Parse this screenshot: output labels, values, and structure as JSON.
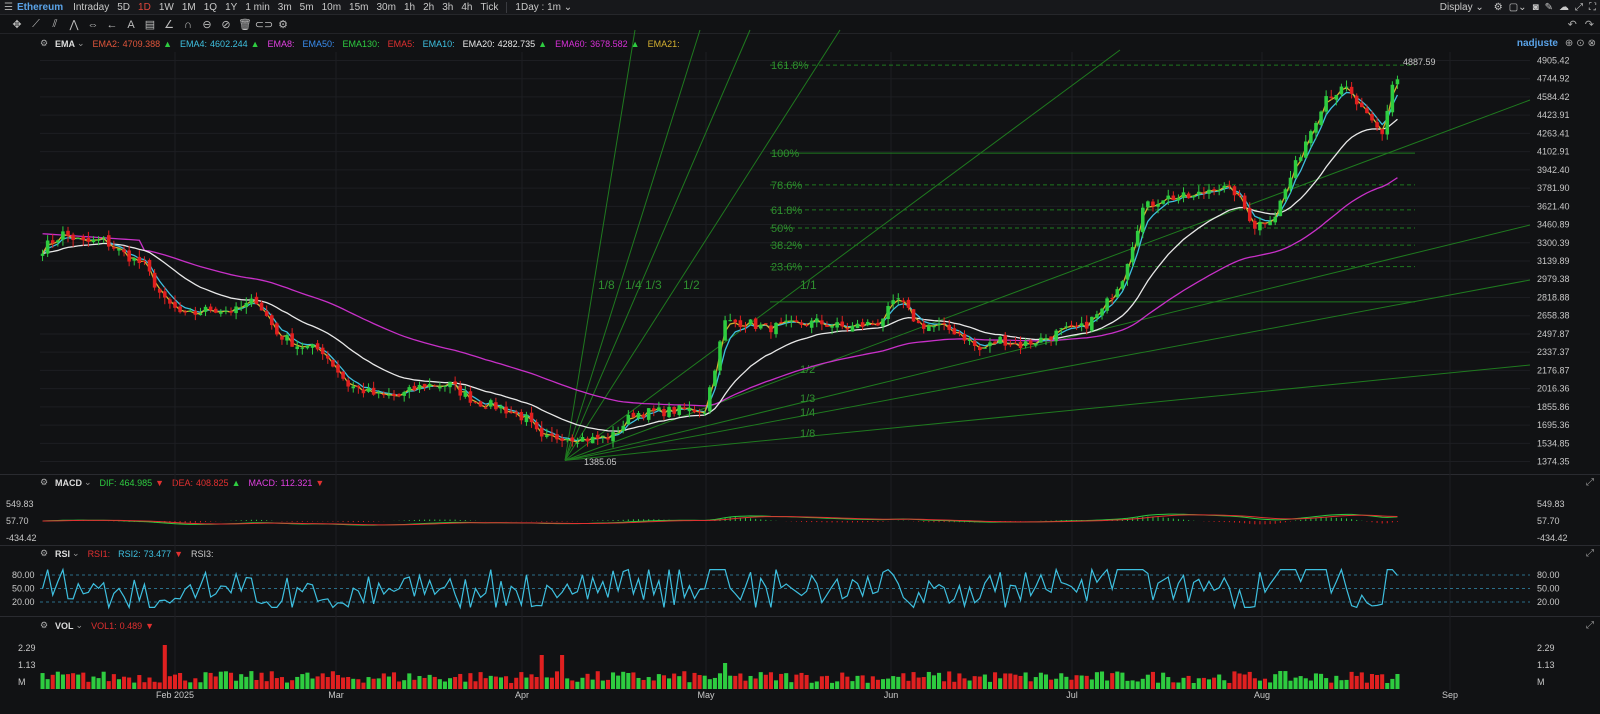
{
  "topbar": {
    "symbol": "Ethereum",
    "intraday": "Intraday",
    "ranges": [
      "5D",
      "1D",
      "1W",
      "1M",
      "1Q",
      "1Y"
    ],
    "active_range": "1D",
    "intervals": [
      "1 min",
      "3m",
      "5m",
      "10m",
      "15m",
      "30m",
      "1h",
      "2h",
      "3h",
      "4h",
      "Tick"
    ],
    "period_select": "1Day : 1m",
    "display": "Display"
  },
  "user": {
    "name": "nadjuste"
  },
  "main_legend": {
    "indicator": "EMA",
    "items": [
      {
        "label": "EMA2:",
        "value": "4709.388",
        "color": "#e0553b",
        "trend": "up"
      },
      {
        "label": "EMA4:",
        "value": "4602.244",
        "color": "#3ec0e0",
        "trend": "up"
      },
      {
        "label": "EMA8:",
        "value": "",
        "color": "#e040e0",
        "trend": ""
      },
      {
        "label": "EMA50:",
        "value": "",
        "color": "#3a8ef0",
        "trend": ""
      },
      {
        "label": "EMA130:",
        "value": "",
        "color": "#2ecc40",
        "trend": ""
      },
      {
        "label": "EMA5:",
        "value": "",
        "color": "#e03030",
        "trend": ""
      },
      {
        "label": "EMA10:",
        "value": "",
        "color": "#3ec0e0",
        "trend": ""
      },
      {
        "label": "EMA20:",
        "value": "4282.735",
        "color": "#e8e8e8",
        "trend": "up"
      },
      {
        "label": "EMA60:",
        "value": "3678.582",
        "color": "#d630d6",
        "trend": "up"
      },
      {
        "label": "EMA21:",
        "value": "",
        "color": "#d4b030",
        "trend": ""
      }
    ]
  },
  "macd_legend": {
    "indicator": "MACD",
    "items": [
      {
        "label": "DIF:",
        "value": "464.985",
        "color": "#2ecc40",
        "trend": "down"
      },
      {
        "label": "DEA:",
        "value": "408.825",
        "color": "#e03030",
        "trend": "up"
      },
      {
        "label": "MACD:",
        "value": "112.321",
        "color": "#e040e0",
        "trend": "down"
      }
    ]
  },
  "rsi_legend": {
    "indicator": "RSI",
    "items": [
      {
        "label": "RSI1:",
        "value": "",
        "color": "#e03030",
        "trend": ""
      },
      {
        "label": "RSI2:",
        "value": "73.477",
        "color": "#3ec0e0",
        "trend": "down"
      },
      {
        "label": "RSI3:",
        "value": "",
        "color": "#cccccc",
        "trend": ""
      }
    ]
  },
  "vol_legend": {
    "indicator": "VOL",
    "items": [
      {
        "label": "VOL1:",
        "value": "0.489",
        "color": "#e03030",
        "trend": "down"
      }
    ]
  },
  "chart_data": {
    "type": "candlestick",
    "x_labels": [
      "Feb 2025",
      "Mar",
      "Apr",
      "May",
      "Jun",
      "Jul",
      "Aug",
      "Sep"
    ],
    "price_axis_ticks": [
      "4905.42",
      "4744.92",
      "4584.42",
      "4423.91",
      "4263.41",
      "4102.91",
      "3942.40",
      "3781.90",
      "3621.40",
      "3460.89",
      "3300.39",
      "3139.89",
      "2979.38",
      "2818.88",
      "2658.38",
      "2497.87",
      "2337.37",
      "2176.87",
      "2016.36",
      "1855.86",
      "1695.36",
      "1534.85",
      "1374.35"
    ],
    "ylim": [
      1300,
      4980
    ],
    "high_label": "4887.59",
    "low_label": "1385.05",
    "fib_levels": [
      {
        "label": "161.8%",
        "value": 4865
      },
      {
        "label": "100%",
        "value": 4090
      },
      {
        "label": "78.6%",
        "value": 3810
      },
      {
        "label": "61.8%",
        "value": 3590
      },
      {
        "label": "50%",
        "value": 3430
      },
      {
        "label": "38.2%",
        "value": 3280
      },
      {
        "label": "23.6%",
        "value": 3090
      },
      {
        "label": "",
        "value": 2780
      }
    ],
    "gann_labels_upper": [
      "1/8",
      "1/4",
      "1/3",
      "1/2",
      "1/1"
    ],
    "gann_labels_lower": [
      "1/2",
      "1/3",
      "1/4",
      "1/8"
    ],
    "macd_axis_ticks": [
      "549.83",
      "57.70",
      "-434.42"
    ],
    "rsi_axis_ticks": [
      "80.00",
      "50.00",
      "20.00"
    ],
    "vol_axis_ticks": [
      "2.29",
      "1.13",
      "M"
    ],
    "anchors": [
      [
        0,
        3250
      ],
      [
        4,
        3380
      ],
      [
        8,
        3300
      ],
      [
        12,
        3320
      ],
      [
        16,
        3200
      ],
      [
        20,
        3100
      ],
      [
        24,
        2780
      ],
      [
        28,
        2650
      ],
      [
        33,
        2720
      ],
      [
        38,
        2700
      ],
      [
        42,
        2800
      ],
      [
        46,
        2500
      ],
      [
        50,
        2400
      ],
      [
        55,
        2350
      ],
      [
        60,
        2050
      ],
      [
        66,
        1950
      ],
      [
        70,
        1950
      ],
      [
        75,
        2050
      ],
      [
        80,
        2050
      ],
      [
        85,
        1900
      ],
      [
        90,
        1850
      ],
      [
        95,
        1750
      ],
      [
        98,
        1560
      ],
      [
        102,
        1600
      ],
      [
        108,
        1570
      ],
      [
        112,
        1600
      ],
      [
        116,
        1800
      ],
      [
        120,
        1810
      ],
      [
        126,
        1830
      ],
      [
        130,
        1830
      ],
      [
        134,
        2600
      ],
      [
        138,
        2600
      ],
      [
        142,
        2550
      ],
      [
        148,
        2580
      ],
      [
        152,
        2600
      ],
      [
        158,
        2550
      ],
      [
        164,
        2600
      ],
      [
        168,
        2800
      ],
      [
        172,
        2580
      ],
      [
        176,
        2560
      ],
      [
        180,
        2510
      ],
      [
        184,
        2350
      ],
      [
        188,
        2450
      ],
      [
        192,
        2400
      ],
      [
        196,
        2450
      ],
      [
        200,
        2520
      ],
      [
        204,
        2550
      ],
      [
        208,
        2700
      ],
      [
        212,
        3000
      ],
      [
        216,
        3600
      ],
      [
        220,
        3700
      ],
      [
        226,
        3700
      ],
      [
        230,
        3800
      ],
      [
        234,
        3750
      ],
      [
        238,
        3450
      ],
      [
        242,
        3550
      ],
      [
        248,
        4200
      ],
      [
        252,
        4600
      ],
      [
        256,
        4650
      ],
      [
        260,
        4400
      ],
      [
        263,
        4250
      ],
      [
        265,
        4700
      ],
      [
        266,
        4740
      ]
    ],
    "candle_count": 267
  }
}
